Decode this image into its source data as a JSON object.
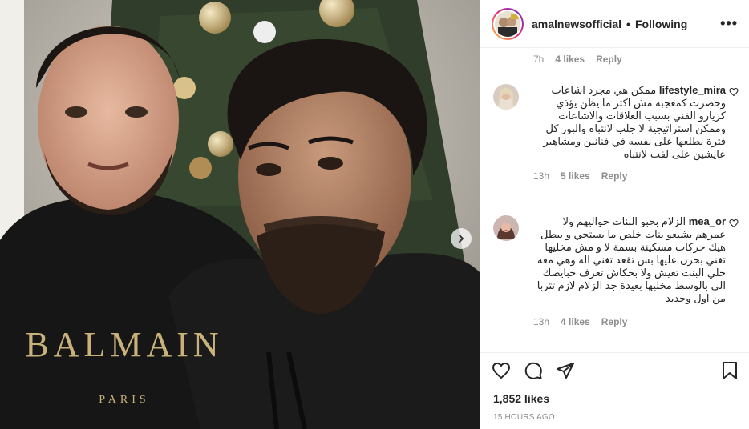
{
  "post": {
    "username": "amalnewsofficial",
    "separator": "•",
    "follow_status": "Following",
    "more_label": "•••",
    "likes": "1,852 likes",
    "timestamp": "15 HOURS AGO"
  },
  "photo": {
    "hoodie_text": "BALMAIN",
    "hoodie_subtext": "PARIS"
  },
  "previous_comment_meta": {
    "time": "7h",
    "likes": "4 likes",
    "reply": "Reply"
  },
  "comments": [
    {
      "username": "lifestyle_mira",
      "text": "ممكن هي مجرد اشاعات وحضرت كمعجبه مش اكتر ما يظن يؤذي كريارو الفني بسبب العلاقات والاشاعات وممكن استراتيجية لا جلب لانتباه والبوز كل فترة يطلعها على نفسه في فنانين ومشاهير عايشين على لفت لانتباه",
      "time": "13h",
      "likes": "5 likes",
      "reply": "Reply"
    },
    {
      "username": "mea_or",
      "text": "الزلام بحبو البنات حواليهم ولا عمرهم بشبعو بنات خلص ما يستحي و يبطل هيك حركات مسكينة بسمة لا و مش مخليها تغني بحزن عليها بس تقعد تغني اله وهي معه خلي البنت تعيش ولا بحكاش تعرف خبايصك الي بالوسط مخليها بعيدة جد الزلام لازم تتربا من اول وجديد",
      "time": "13h",
      "likes": "4 likes",
      "reply": "Reply"
    }
  ],
  "colors": {
    "text": "#262626",
    "muted": "#8e8e8e",
    "border": "#efefef"
  }
}
